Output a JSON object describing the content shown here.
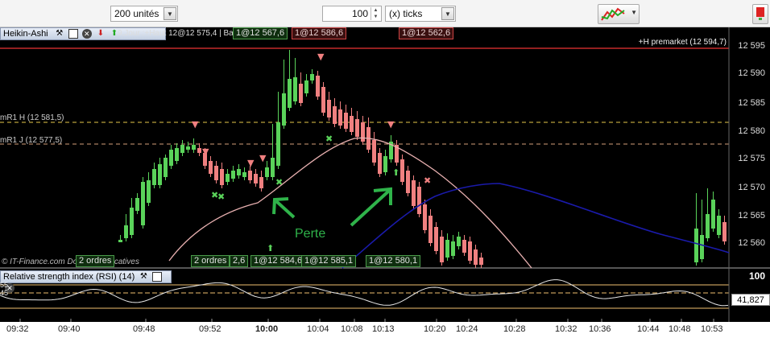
{
  "toolbar": {
    "units_select": "200 unités",
    "quantity_value": "100",
    "ticks_select": "(x) ticks"
  },
  "chart_panel": {
    "title": "Heikin-Ashi",
    "obscured_header_text": "9,Jour :+Haut 12@12 575,4 | Bas 12 562",
    "premarket_label": "+H premarket (12 594,7)",
    "level_h": "mR1 H (12 581,5)",
    "level_j": "mR1 J (12 577,5)",
    "annotation": "Perte",
    "watermark": "© IT-Finance.com Données indicatives"
  },
  "price_axis": [
    "12 595",
    "12 590",
    "12 585",
    "12 580",
    "12 575",
    "12 570",
    "12 565",
    "12 560"
  ],
  "orders_top": [
    {
      "label": "1@12 567,6",
      "color": "green"
    },
    {
      "label": "1@12 586,6",
      "color": "red"
    },
    {
      "label": "1@12 562,6",
      "color": "red"
    }
  ],
  "orders_bottom": [
    {
      "label": "2 ordres",
      "color": "green"
    },
    {
      "label": "2 ordres",
      "color": "green"
    },
    {
      "label": "2,6",
      "color": "green"
    },
    {
      "label": "1@12 584,6",
      "color": "green"
    },
    {
      "label": "1@12 585,1",
      "color": "green"
    },
    {
      "label": "1@12 580,1",
      "color": "green"
    }
  ],
  "rsi_panel": {
    "title": "Relative strength index (RSI) (14)",
    "value": "41,827",
    "axis_top": "100",
    "level_upper": "55",
    "level_lower": "45"
  },
  "time_axis": [
    {
      "label": "09:32",
      "bold": false
    },
    {
      "label": "09:40",
      "bold": false
    },
    {
      "label": "09:48",
      "bold": false
    },
    {
      "label": "09:52",
      "bold": false
    },
    {
      "label": "10:00",
      "bold": true
    },
    {
      "label": "10:04",
      "bold": false
    },
    {
      "label": "10:08",
      "bold": false
    },
    {
      "label": "10:13",
      "bold": false
    },
    {
      "label": "10:20",
      "bold": false
    },
    {
      "label": "10:24",
      "bold": false
    },
    {
      "label": "10:28",
      "bold": false
    },
    {
      "label": "10:32",
      "bold": false
    },
    {
      "label": "10:36",
      "bold": false
    },
    {
      "label": "10:44",
      "bold": false
    },
    {
      "label": "10:48",
      "bold": false
    },
    {
      "label": "10:53",
      "bold": false
    }
  ],
  "colors": {
    "bull": "#5ad35a",
    "bear": "#f08080",
    "ma_short": "#e8b0b0",
    "ma_long": "#1a1aaa",
    "premarket": "#c42b2b",
    "level_h": "#e6c84a",
    "level_j": "#d6a07a",
    "annotation": "#2fb34a"
  }
}
